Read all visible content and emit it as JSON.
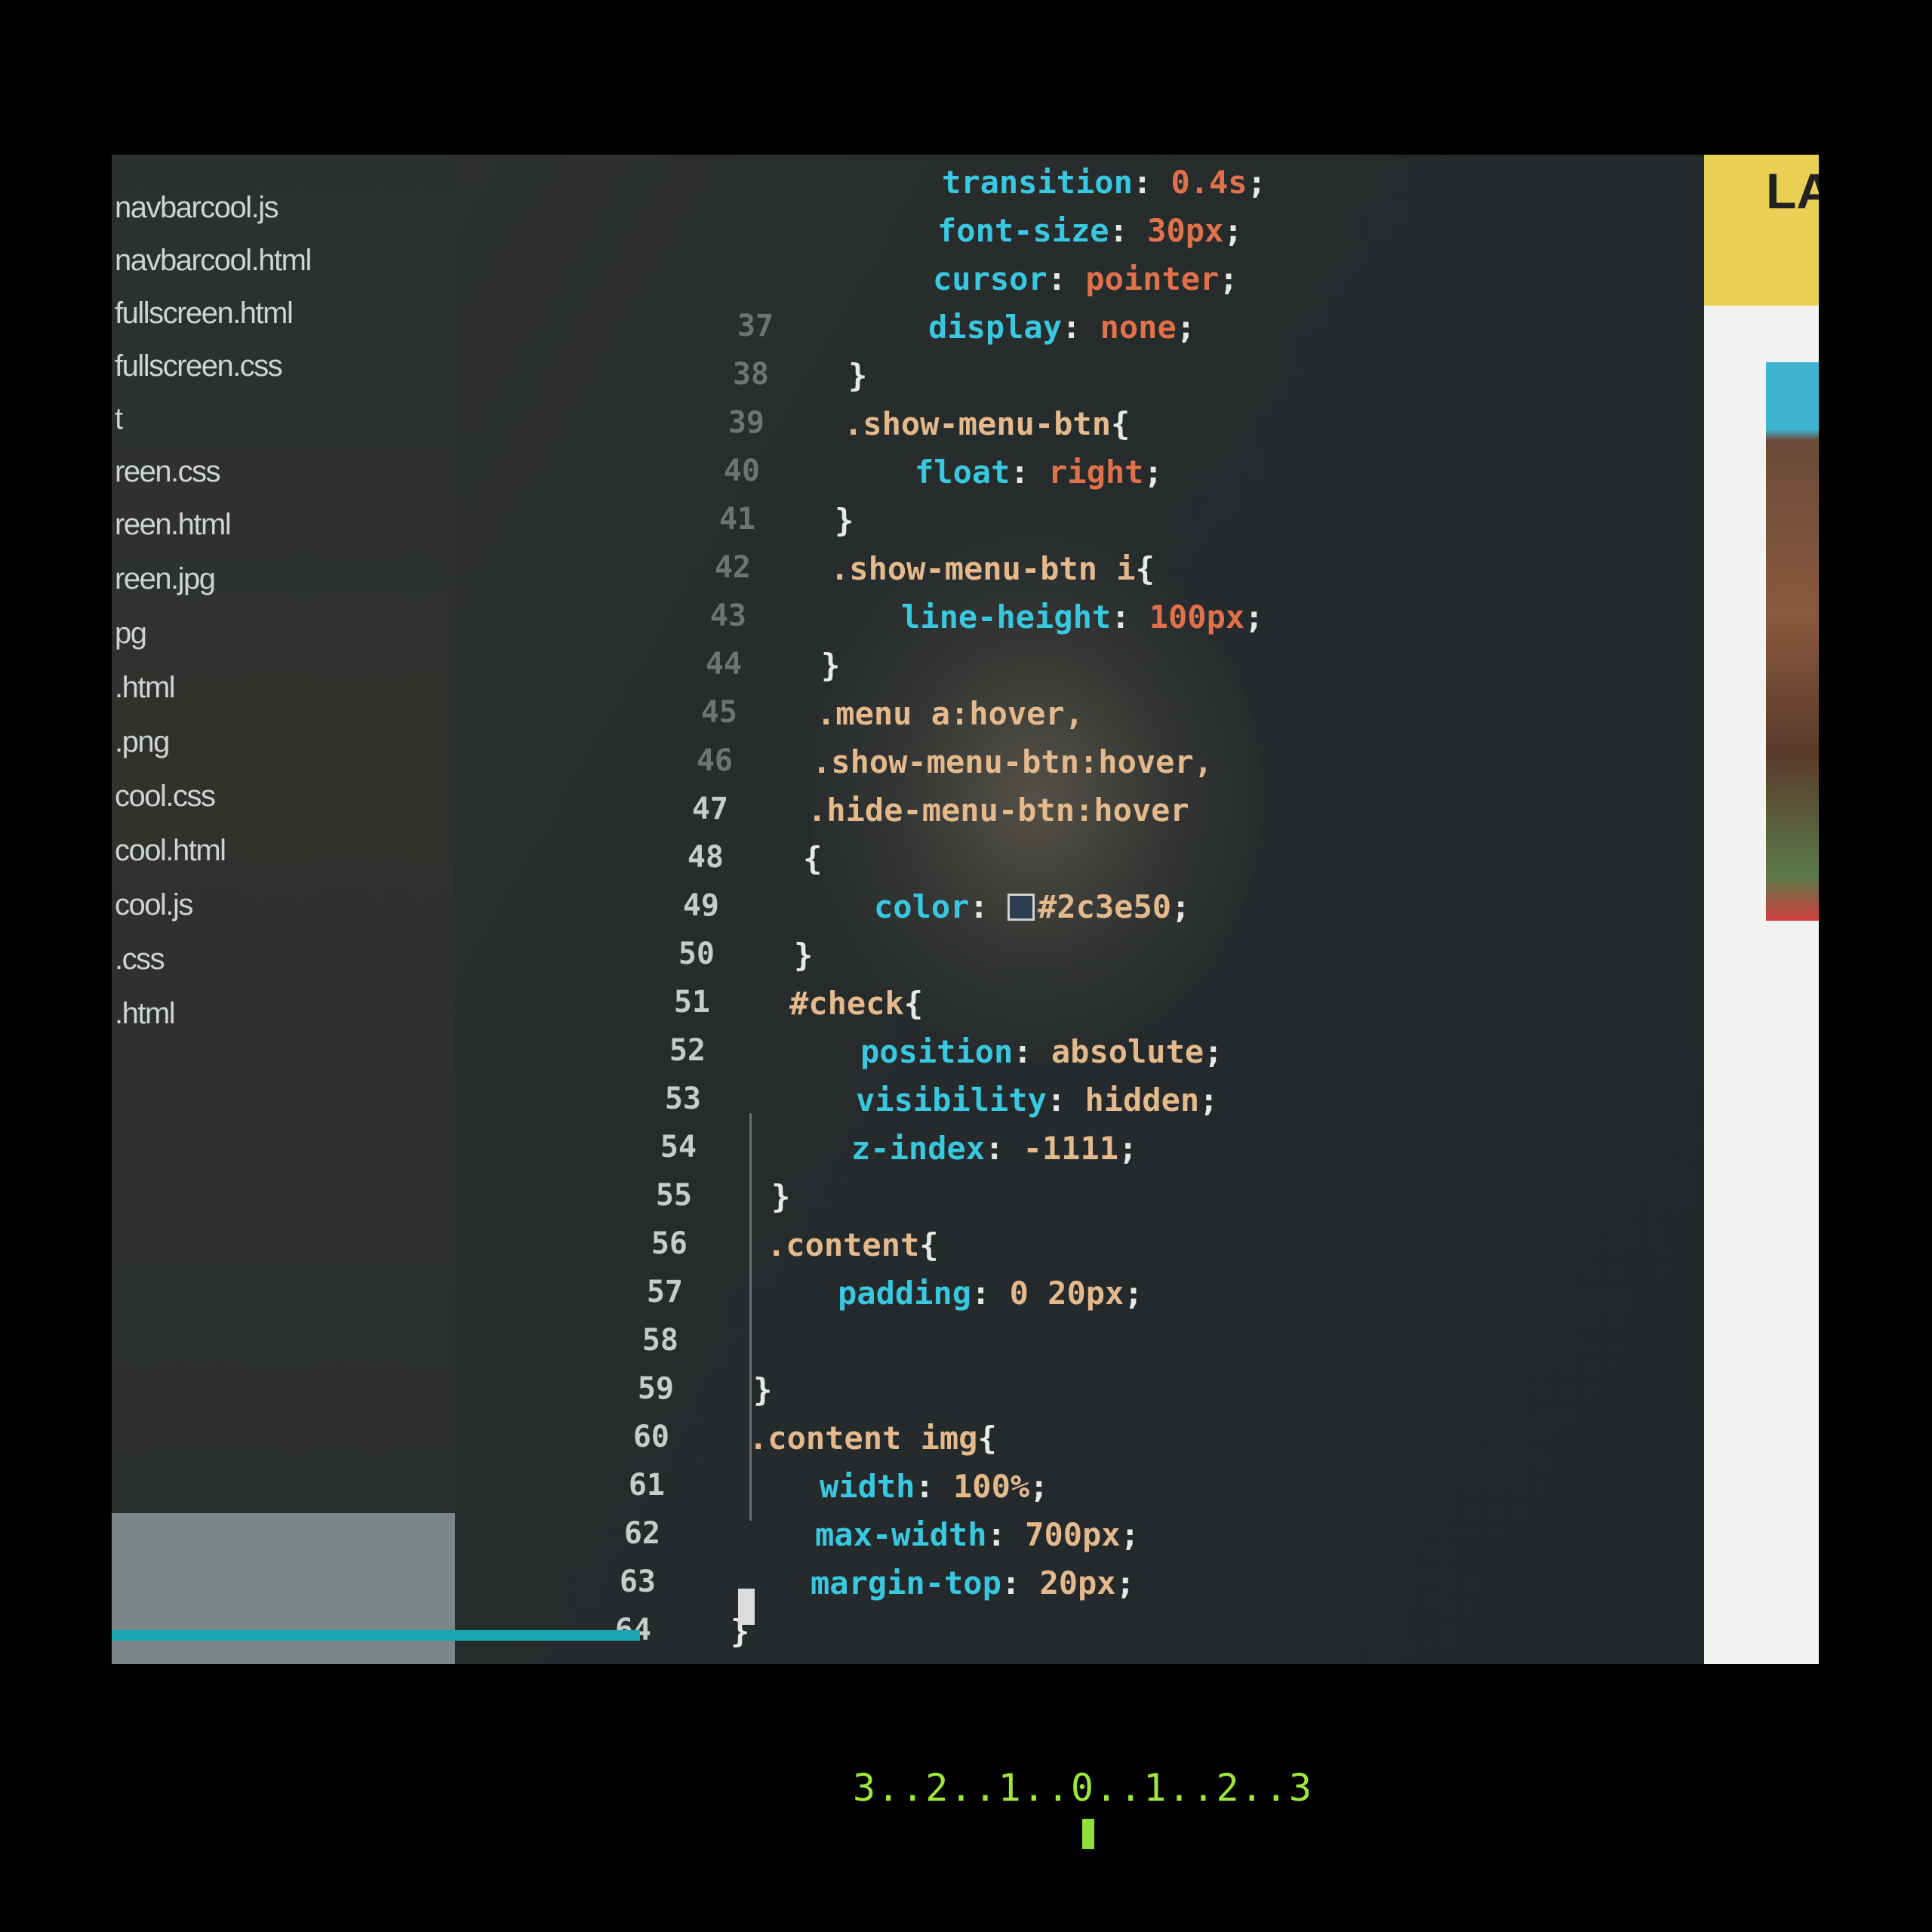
{
  "sidebar": {
    "files": [
      "navbarcool.js",
      "navbarcool.html",
      "fullscreen.html",
      "fullscreen.css",
      "t",
      "reen.css",
      "reen.html",
      "reen.jpg",
      "pg",
      ".html",
      ".png",
      "cool.css",
      "cool.html",
      "cool.js",
      ".css",
      ".html"
    ]
  },
  "editor": {
    "line_numbers": [
      "37",
      "38",
      "39",
      "40",
      "41",
      "42",
      "43",
      "44",
      "45",
      "46",
      "47",
      "48",
      "49",
      "50",
      "51",
      "52",
      "53",
      "54",
      "55",
      "56",
      "57",
      "58",
      "59",
      "60",
      "61",
      "62",
      "63",
      "64"
    ],
    "lines": [
      {
        "prop": "transition",
        "sep": ": ",
        "val": "0.4s",
        "end": ";"
      },
      {
        "prop": "font-size",
        "sep": ": ",
        "val": "30px",
        "end": ";"
      },
      {
        "prop": "cursor",
        "sep": ": ",
        "val": "pointer",
        "end": ";"
      },
      {
        "prop": "display",
        "sep": ": ",
        "val": "none",
        "end": ";"
      },
      {
        "text": "}"
      },
      {
        "sel": ".show-menu-btn",
        "end": "{"
      },
      {
        "prop": "float",
        "sep": ": ",
        "val": "right",
        "end": ";"
      },
      {
        "text": "}"
      },
      {
        "sel": ".show-menu-btn i",
        "end": "{"
      },
      {
        "prop": "line-height",
        "sep": ": ",
        "val": "100px",
        "end": ";"
      },
      {
        "text": "}"
      },
      {
        "sel": ".menu a:hover,"
      },
      {
        "sel": ".show-menu-btn:hover,"
      },
      {
        "sel": ".hide-menu-btn:hover"
      },
      {
        "text": "{"
      },
      {
        "prop": "color",
        "sep": ": ",
        "val": "#2c3e50",
        "end": ";"
      },
      {
        "text": "}"
      },
      {
        "sel": "#check",
        "end": "{"
      },
      {
        "prop": "position",
        "sep": ": ",
        "val": "absolute",
        "end": ";"
      },
      {
        "prop": "visibility",
        "sep": ": ",
        "val": "hidden",
        "end": ";"
      },
      {
        "prop": "z-index",
        "sep": ": ",
        "val": "-1111",
        "end": ";"
      },
      {
        "text": "}"
      },
      {
        "sel": ".content",
        "end": "{"
      },
      {
        "prop": "padding",
        "sep": ": ",
        "val": "0 20px",
        "end": ";"
      },
      {
        "text": ""
      },
      {
        "text": "}"
      },
      {
        "sel": ".content img",
        "end": "{"
      },
      {
        "prop": "width",
        "sep": ": ",
        "val": "100%",
        "end": ";"
      },
      {
        "prop": "max-width",
        "sep": ": ",
        "val": "700px",
        "end": ";"
      },
      {
        "prop": "margin-top",
        "sep": ": ",
        "val": "20px",
        "end": ";"
      },
      {
        "text": "}"
      }
    ],
    "color_swatch": "#2c3e50"
  },
  "preview": {
    "title": "LA"
  },
  "hud": {
    "scale": "3..2..1..0..1..2..3"
  }
}
